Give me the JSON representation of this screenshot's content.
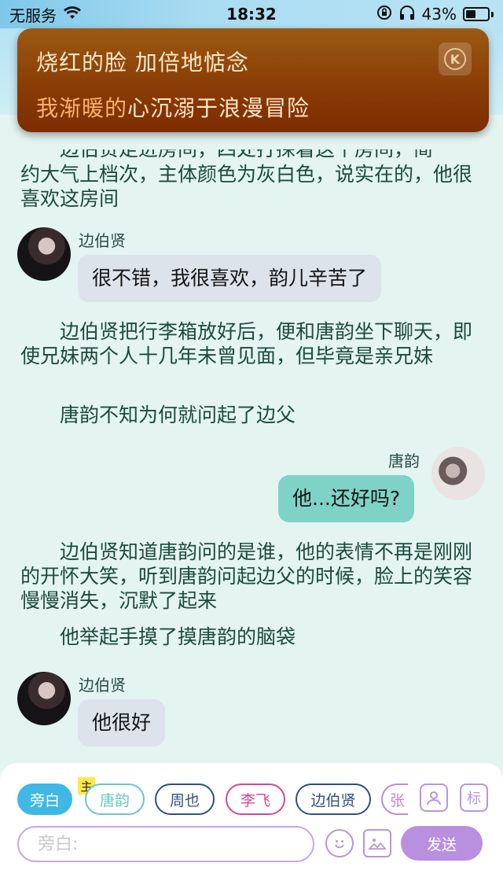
{
  "status_bar": {
    "carrier": "无服务",
    "time": "18:32",
    "battery": "43%"
  },
  "lyric": {
    "line1": "烧红的脸 加倍地惦念",
    "line2_highlight": "我渐暖的",
    "line2_rest": "心沉溺于浪漫冒险"
  },
  "chat": {
    "partial_top_line": "边伯贤走进房间，四处打探着这个房间，简",
    "narration_1": "约大气上档次，主体颜色为灰白色，说实在的，他很喜欢这房间",
    "msg_1": {
      "speaker": "边伯贤",
      "text": "很不错，我很喜欢，韵儿辛苦了"
    },
    "narration_2": "边伯贤把行李箱放好后，便和唐韵坐下聊天，即使兄妹两个人十几年未曾见面，但毕竟是亲兄妹",
    "narration_3": "唐韵不知为何就问起了边父",
    "msg_2": {
      "speaker": "唐韵",
      "text": "他...还好吗?"
    },
    "narration_4": "边伯贤知道唐韵问的是谁，他的表情不再是刚刚的开怀大笑，听到唐韵问起边父的时候，脸上的笑容慢慢消失，沉默了起来",
    "narration_5": "他举起手摸了摸唐韵的脑袋",
    "msg_3": {
      "speaker": "边伯贤",
      "text": "他很好"
    }
  },
  "composer": {
    "roles": [
      "旁白",
      "唐韵",
      "周也",
      "李飞",
      "边伯贤",
      "张"
    ],
    "main_tag": "主",
    "tag_button": "标",
    "input_placeholder": "旁白:",
    "send_label": "发送"
  },
  "colors": {
    "narrator_role": "#3fb8e6",
    "tangyun_role": "#6cc7bd",
    "zhouye_role": "#2f4f86",
    "lifei_role": "#d04a8f",
    "bianboxian_role": "#2f4f86",
    "zhang_role": "#c983d6",
    "send": "#b990e0"
  }
}
